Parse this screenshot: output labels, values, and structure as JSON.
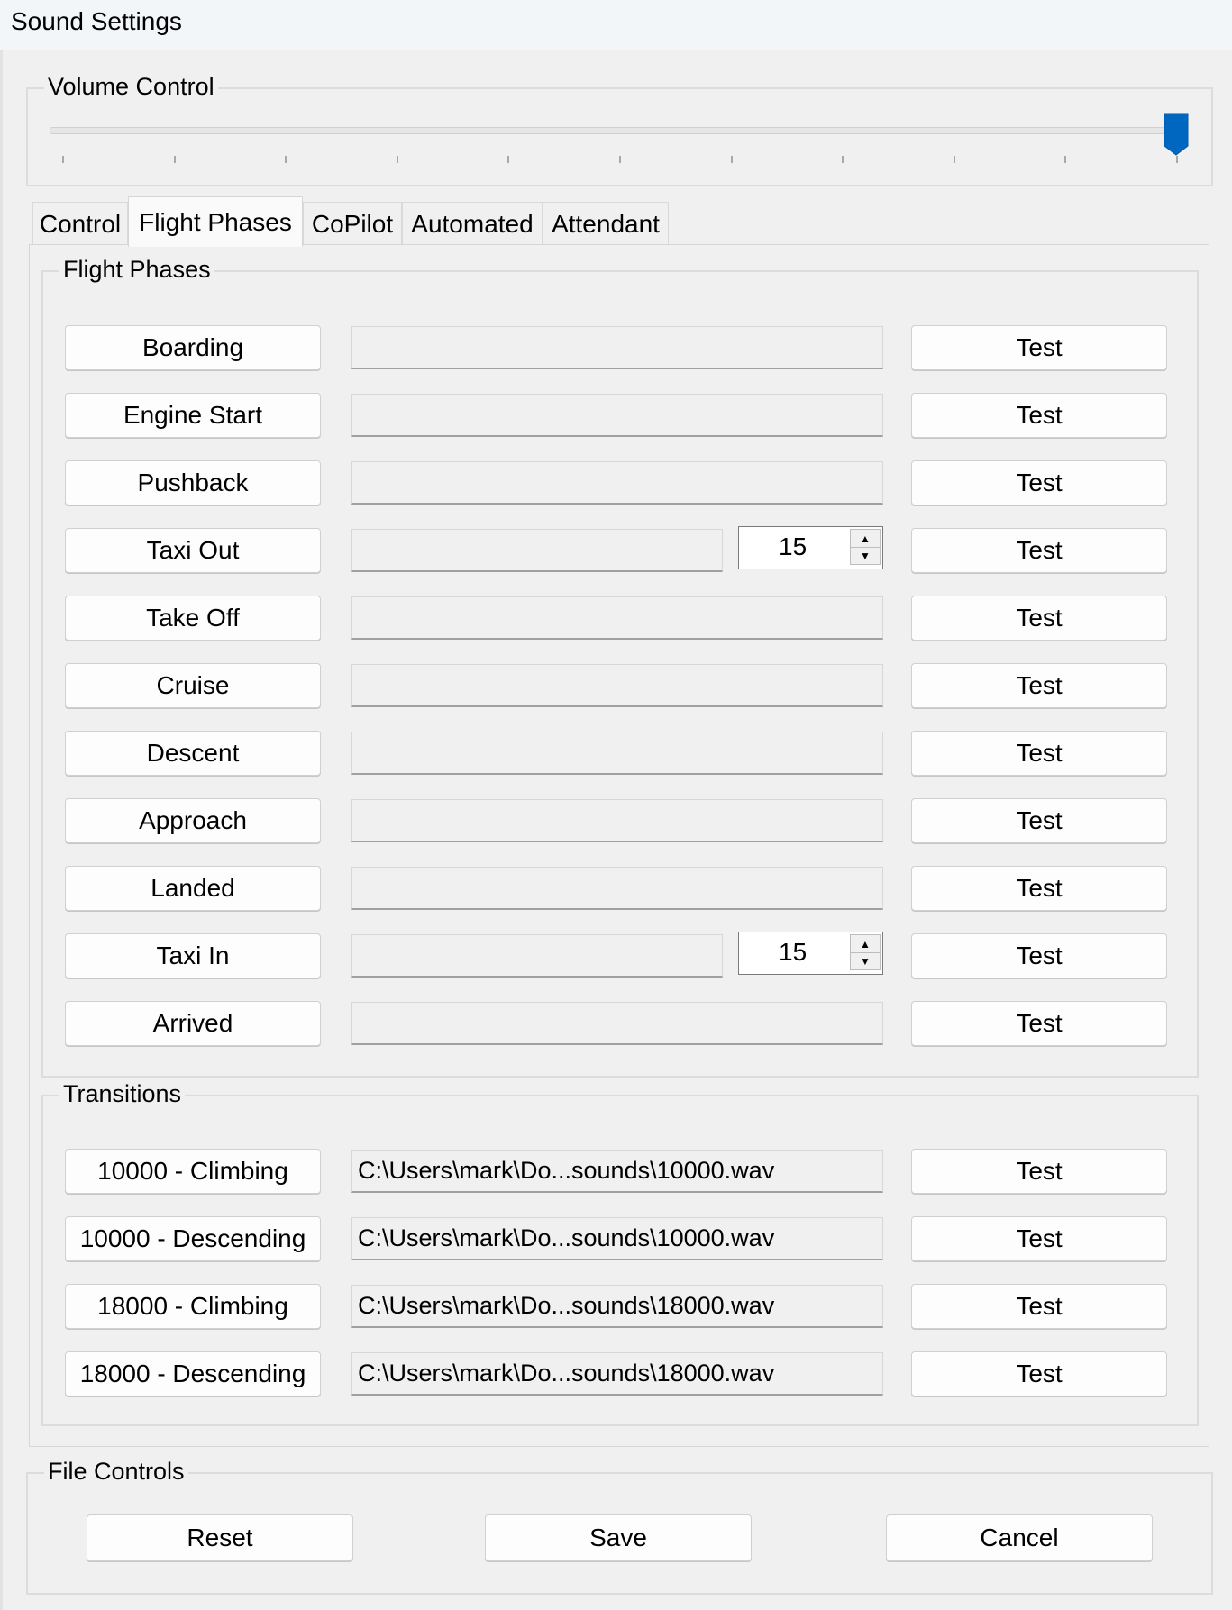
{
  "window": {
    "title": "Sound Settings"
  },
  "volume": {
    "label": "Volume Control",
    "level_percent": 100,
    "tick_count": 11,
    "accent": "#0067c0"
  },
  "tabs": [
    {
      "label": "Control",
      "active": false
    },
    {
      "label": "Flight Phases",
      "active": true
    },
    {
      "label": "CoPilot",
      "active": false
    },
    {
      "label": "Automated",
      "active": false
    },
    {
      "label": "Attendant",
      "active": false
    }
  ],
  "flight_phases": {
    "label": "Flight Phases",
    "rows": [
      {
        "name": "Boarding",
        "path": "",
        "test": "Test"
      },
      {
        "name": "Engine Start",
        "path": "",
        "test": "Test"
      },
      {
        "name": "Pushback",
        "path": "",
        "test": "Test"
      },
      {
        "name": "Taxi Out",
        "path": "",
        "test": "Test",
        "spinner": "15"
      },
      {
        "name": "Take Off",
        "path": "",
        "test": "Test"
      },
      {
        "name": "Cruise",
        "path": "",
        "test": "Test"
      },
      {
        "name": "Descent",
        "path": "",
        "test": "Test"
      },
      {
        "name": "Approach",
        "path": "",
        "test": "Test"
      },
      {
        "name": "Landed",
        "path": "",
        "test": "Test"
      },
      {
        "name": "Taxi In",
        "path": "",
        "test": "Test",
        "spinner": "15"
      },
      {
        "name": "Arrived",
        "path": "",
        "test": "Test"
      }
    ]
  },
  "transitions": {
    "label": "Transitions",
    "rows": [
      {
        "name": "10000 - Climbing",
        "path": "C:\\Users\\mark\\Do...sounds\\10000.wav",
        "test": "Test"
      },
      {
        "name": "10000 - Descending",
        "path": "C:\\Users\\mark\\Do...sounds\\10000.wav",
        "test": "Test"
      },
      {
        "name": "18000 - Climbing",
        "path": "C:\\Users\\mark\\Do...sounds\\18000.wav",
        "test": "Test"
      },
      {
        "name": "18000 - Descending",
        "path": "C:\\Users\\mark\\Do...sounds\\18000.wav",
        "test": "Test"
      }
    ]
  },
  "file_controls": {
    "label": "File Controls",
    "reset": "Reset",
    "save": "Save",
    "cancel": "Cancel"
  }
}
